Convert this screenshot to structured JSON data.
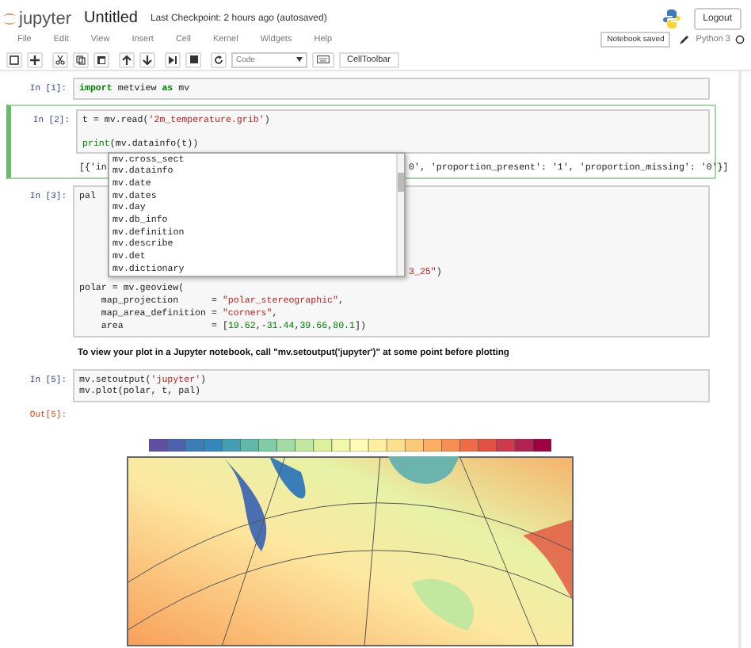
{
  "header": {
    "logo": "jupyter",
    "title": "Untitled",
    "checkpoint": "Last Checkpoint: 2 hours ago (autosaved)",
    "logout": "Logout"
  },
  "menu": [
    "File",
    "Edit",
    "View",
    "Insert",
    "Cell",
    "Kernel",
    "Widgets",
    "Help"
  ],
  "status": {
    "notebook": "Notebook saved",
    "kernel": "Python 3"
  },
  "toolbar": {
    "buttons": [
      {
        "kind": "save"
      },
      {
        "kind": "add"
      },
      {
        "kind": "cut"
      },
      {
        "kind": "copy"
      },
      {
        "kind": "paste"
      },
      {
        "kind": "up"
      },
      {
        "kind": "down"
      },
      {
        "kind": "step"
      },
      {
        "kind": "stop"
      },
      {
        "kind": "restart"
      }
    ],
    "cell_type": "Code",
    "celltoolbar": "CellToolbar"
  },
  "cells": [
    {
      "kind": "code",
      "prompt": "In [1]:",
      "selected": false,
      "lines": [
        {
          "kind": "code",
          "tokens": [
            {
              "kind": "kw",
              "text": "import"
            },
            {
              "kind": "plain",
              "text": " metview "
            },
            {
              "kind": "kw",
              "text": "as"
            },
            {
              "kind": "plain",
              "text": " mv"
            }
          ]
        }
      ]
    },
    {
      "kind": "code",
      "prompt": "In [2]:",
      "selected": true,
      "lines": [
        {
          "kind": "code",
          "tokens": [
            {
              "kind": "plain",
              "text": "t = mv.read("
            },
            {
              "kind": "str",
              "text": "'2m_temperature.grib'"
            },
            {
              "kind": "plain",
              "text": ")"
            }
          ]
        },
        {
          "kind": "blank"
        },
        {
          "kind": "code",
          "tokens": [
            {
              "kind": "fn",
              "text": "print"
            },
            {
              "kind": "plain",
              "text": "(mv.datainfo(t))"
            }
          ]
        }
      ],
      "output": {
        "left": "[{'in",
        "right": "0', 'proportion_present': '1', 'proportion_missing': '0'}]"
      }
    },
    {
      "kind": "code",
      "prompt": "In [3]:",
      "selected": false,
      "lines": [
        {
          "kind": "code",
          "tokens": [
            {
              "kind": "plain",
              "text": "pal"
            }
          ]
        },
        {
          "kind": "blank"
        },
        {
          "kind": "blank"
        },
        {
          "kind": "blank"
        },
        {
          "kind": "blank"
        },
        {
          "kind": "blank"
        },
        {
          "kind": "code",
          "right": [
            {
              "kind": "str",
              "text": "3_25\""
            },
            {
              "kind": "plain",
              "text": ")"
            }
          ]
        },
        {
          "kind": "gap"
        },
        {
          "kind": "code",
          "tokens": [
            {
              "kind": "plain",
              "text": "polar = mv.geoview("
            }
          ]
        },
        {
          "kind": "code",
          "tokens": [
            {
              "kind": "plain",
              "text": "    map_projection      = "
            },
            {
              "kind": "str",
              "text": "\"polar_stereographic\""
            },
            {
              "kind": "plain",
              "text": ","
            }
          ]
        },
        {
          "kind": "code",
          "tokens": [
            {
              "kind": "plain",
              "text": "    map_area_definition = "
            },
            {
              "kind": "str",
              "text": "\"corners\""
            },
            {
              "kind": "plain",
              "text": ","
            }
          ]
        },
        {
          "kind": "code",
          "tokens": [
            {
              "kind": "plain",
              "text": "    area                = ["
            },
            {
              "kind": "num",
              "text": "19.62"
            },
            {
              "kind": "plain",
              "text": ",-"
            },
            {
              "kind": "num",
              "text": "31.44"
            },
            {
              "kind": "plain",
              "text": ","
            },
            {
              "kind": "num",
              "text": "39.66"
            },
            {
              "kind": "plain",
              "text": ","
            },
            {
              "kind": "num",
              "text": "80.1"
            },
            {
              "kind": "plain",
              "text": "])"
            }
          ]
        }
      ]
    },
    {
      "kind": "markdown",
      "text": "To view your plot in a Jupyter notebook, call \"mv.setoutput('jupyter')\" at some point before plotting"
    },
    {
      "kind": "code",
      "prompt": "In [5]:",
      "selected": false,
      "lines": [
        {
          "kind": "code",
          "tokens": [
            {
              "kind": "plain",
              "text": "mv.setoutput("
            },
            {
              "kind": "str",
              "text": "'jupyter'"
            },
            {
              "kind": "plain",
              "text": ")"
            }
          ]
        },
        {
          "kind": "code",
          "tokens": [
            {
              "kind": "plain",
              "text": "mv.plot(polar, t, pal)"
            }
          ]
        }
      ],
      "out_prompt": "Out[5]:"
    }
  ],
  "completion": {
    "items": [
      {
        "text": "mv.cross_sect",
        "selected": false
      },
      {
        "text": "mv.datainfo",
        "selected": false
      },
      {
        "text": "mv.date",
        "selected": false
      },
      {
        "text": "mv.dates",
        "selected": false
      },
      {
        "text": "mv.day",
        "selected": false
      },
      {
        "text": "mv.db_info",
        "selected": false
      },
      {
        "text": "mv.definition",
        "selected": false
      },
      {
        "text": "mv.describe",
        "selected": false
      },
      {
        "text": "mv.det",
        "selected": false
      },
      {
        "text": "mv.dictionary",
        "selected": false
      }
    ]
  }
}
